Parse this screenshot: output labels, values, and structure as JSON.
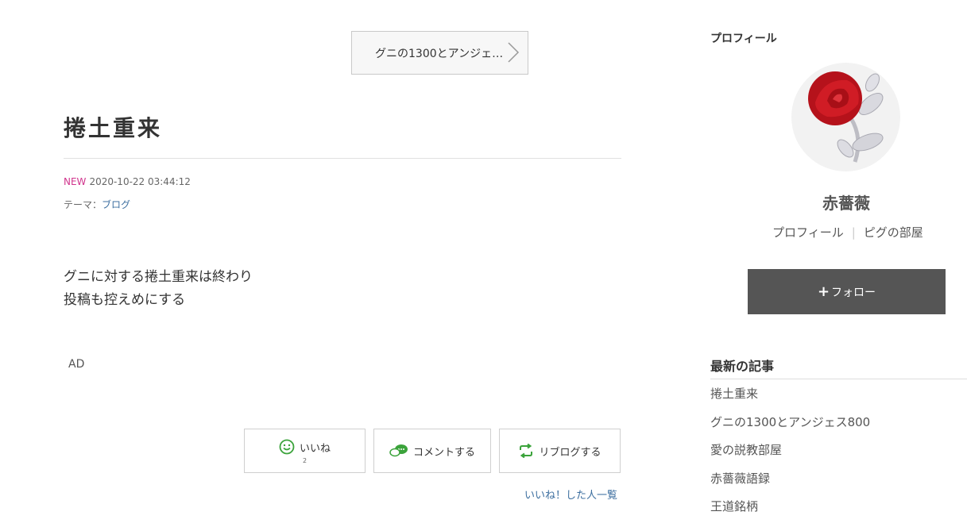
{
  "nav": {
    "prev_article_label": "グニの1300とアンジェ…"
  },
  "article": {
    "title": "捲土重来",
    "new_badge": "NEW",
    "datetime": "2020-10-22 03:44:12",
    "theme_prefix": "テーマ：",
    "theme_link": "ブログ",
    "body_lines": [
      "グニに対する捲土重来は終わり",
      "投稿も控えめにする"
    ],
    "ad_label": "AD"
  },
  "actions": {
    "like_label": "いいね",
    "like_count": "2",
    "comment_label": "コメントする",
    "reblog_label": "リブログする",
    "likes_list_link": "いいね！した人一覧"
  },
  "sidebar": {
    "profile_heading": "プロフィール",
    "name": "赤薔薇",
    "profile_link": "プロフィール",
    "room_link": "ピグの部屋",
    "follow_label": "フォロー",
    "latest_heading": "最新の記事",
    "latest_items": [
      "捲土重来",
      "グニの1300とアンジェス800",
      "愛の説教部屋",
      "赤薔薇語録",
      "王道銘柄"
    ]
  },
  "colors": {
    "new_badge": "#d0358d",
    "link": "#3d6fa0",
    "follow_bg": "#555555",
    "icon_green": "#3ba33b"
  }
}
